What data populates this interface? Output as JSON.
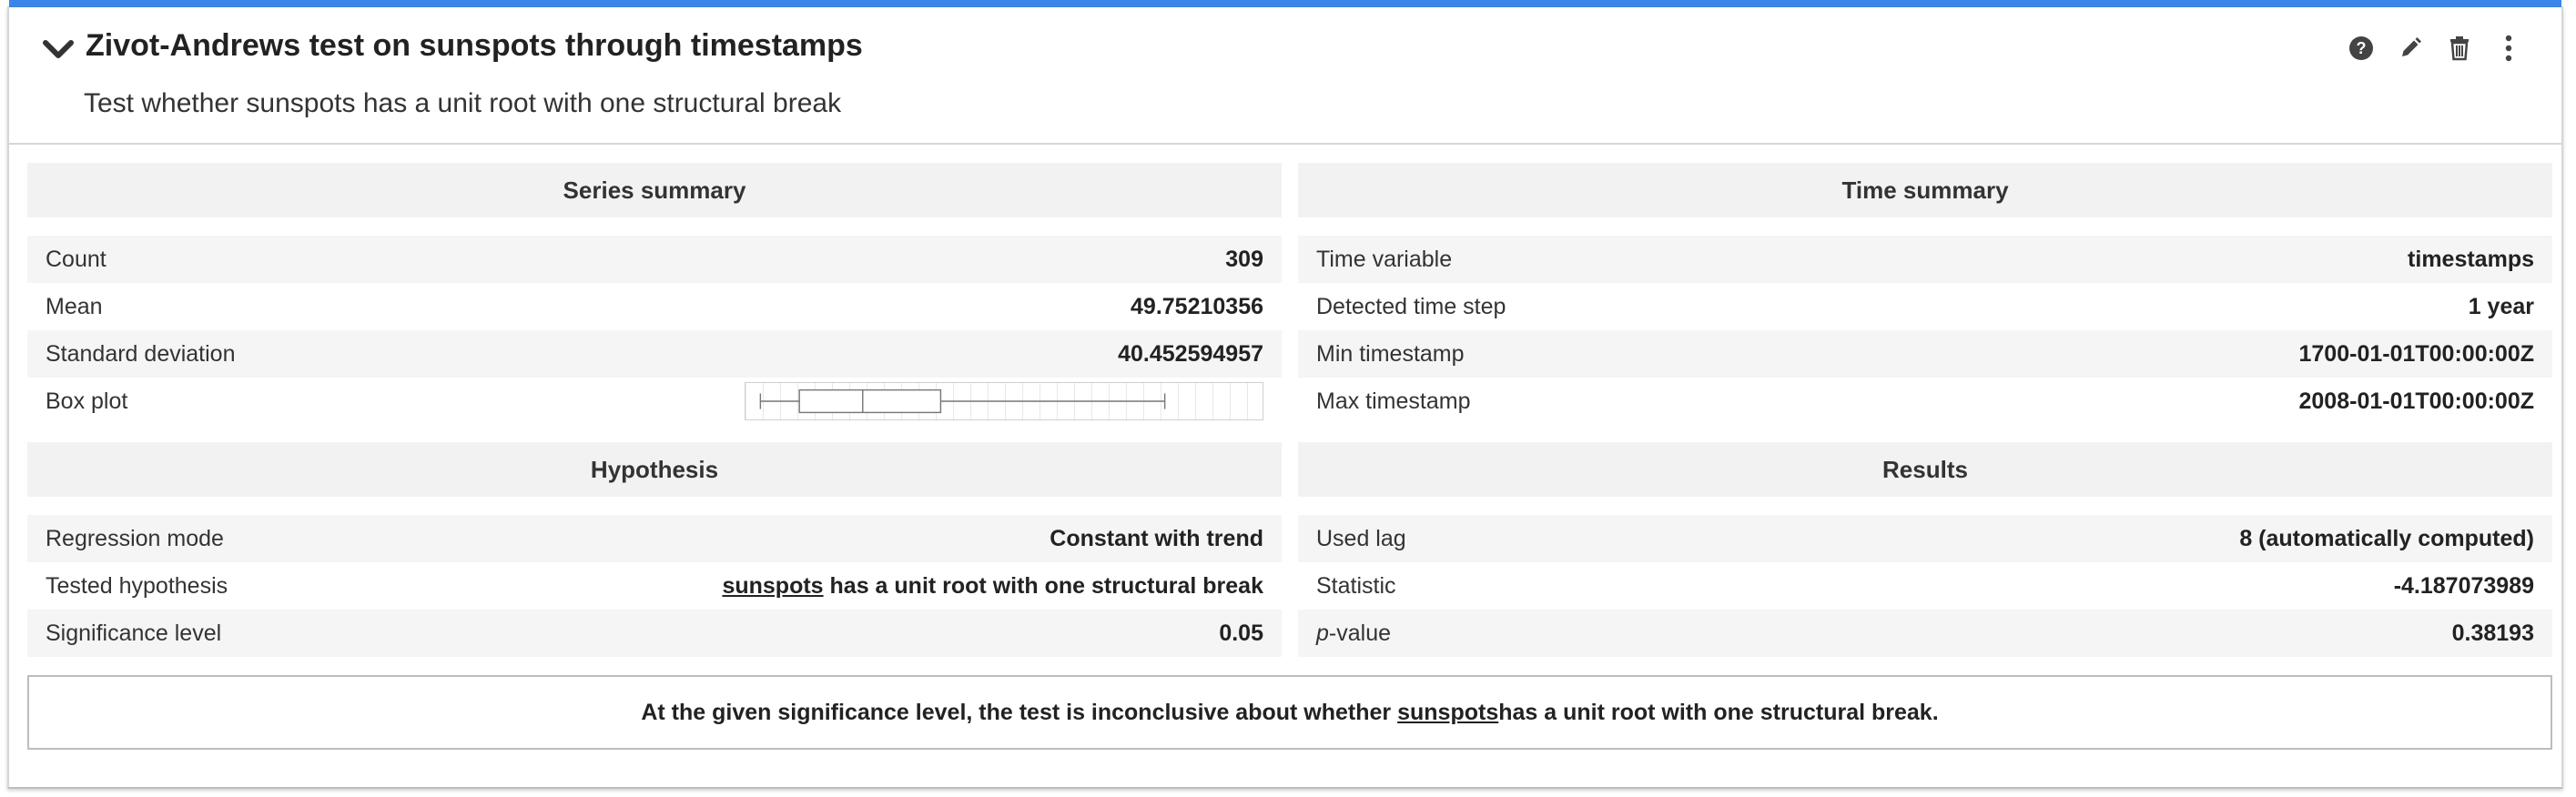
{
  "header": {
    "title": "Zivot-Andrews test on sunspots through timestamps",
    "subtitle": "Test whether sunspots has a unit root with one structural break",
    "actions": [
      "help-icon",
      "edit-icon",
      "trash-icon",
      "more-icon"
    ]
  },
  "series_summary": {
    "title": "Series summary",
    "rows": [
      {
        "label": "Count",
        "value": "309"
      },
      {
        "label": "Mean",
        "value": "49.75210356"
      },
      {
        "label": "Standard deviation",
        "value": "40.452594957"
      },
      {
        "label": "Box plot"
      }
    ],
    "boxplot": {
      "whisker_low": 0.0,
      "q1": 0.08,
      "median": 0.21,
      "q3": 0.37,
      "whisker_high": 0.83
    }
  },
  "time_summary": {
    "title": "Time summary",
    "rows": [
      {
        "label": "Time variable",
        "value": "timestamps"
      },
      {
        "label": "Detected time step",
        "value": "1 year"
      },
      {
        "label": "Min timestamp",
        "value": "1700-01-01T00:00:00Z"
      },
      {
        "label": "Max timestamp",
        "value": "2008-01-01T00:00:00Z"
      }
    ]
  },
  "hypothesis": {
    "title": "Hypothesis",
    "rows": [
      {
        "label": "Regression mode",
        "value": "Constant with trend"
      },
      {
        "label": "Tested hypothesis",
        "value_var": "sunspots",
        "value_rest": " has a unit root with one structural break"
      },
      {
        "label": "Significance level",
        "value": "0.05"
      }
    ]
  },
  "results": {
    "title": "Results",
    "rows": [
      {
        "label": "Used lag",
        "value": "8 (automatically computed)"
      },
      {
        "label": "Statistic",
        "value": "-4.187073989"
      },
      {
        "label_italic": "p",
        "label_rest": "-value",
        "value": "0.38193"
      }
    ]
  },
  "conclusion": {
    "prefix": "At the given significance level, the test is inconclusive about whether ",
    "variable": "sunspots",
    "suffix": " has a unit root with one structural break."
  },
  "colors": {
    "accent": "#3b86e8",
    "section_header_bg": "#f2f2f2",
    "row_alt_bg": "#f5f5f5"
  }
}
